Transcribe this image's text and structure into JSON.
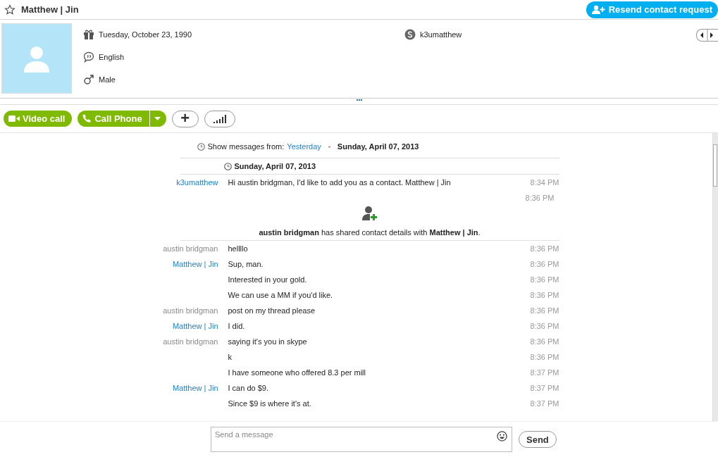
{
  "header": {
    "title": "Matthew | Jin",
    "favorite": false,
    "resend_button": "Resend contact request"
  },
  "profile": {
    "fields": [
      {
        "kind": "birthday",
        "text": "Tuesday, October 23, 1990"
      },
      {
        "kind": "language",
        "text": "English"
      },
      {
        "kind": "gender",
        "text": "Male"
      }
    ],
    "skype_name": "k3umatthew"
  },
  "toolbar": {
    "video_call": "Video call",
    "call_phone": "Call Phone",
    "add_symbol": "+"
  },
  "history": {
    "show_from_label": "Show messages from:",
    "show_from_link": "Yesterday",
    "current_date": "Sunday, April 07, 2013"
  },
  "date_header": "Sunday, April 07, 2013",
  "messages": [
    {
      "kind": "message",
      "sender": "k3umatthew",
      "color": "#1e82d2",
      "text": "Hi austin bridgman, I'd like to add you as a contact. Matthew | Jin",
      "time": "8:34 PM"
    },
    {
      "kind": "share",
      "text": "**austin bridgman** has shared contact details with **Matthew | Jin**.",
      "time": "8:36 PM"
    },
    {
      "kind": "message",
      "sender": "austin bridgman",
      "color": "#8a8a8a",
      "text": "hellllo",
      "time": "8:36 PM"
    },
    {
      "kind": "message",
      "sender": "Matthew | Jin",
      "color": "#1e82d2",
      "text": "Sup, man.",
      "time": "8:36 PM"
    },
    {
      "kind": "message",
      "text": "Interested in your gold.",
      "time": "8:36 PM"
    },
    {
      "kind": "message",
      "text": "We can use a MM if you'd like.",
      "time": "8:36 PM"
    },
    {
      "kind": "message",
      "sender": "austin bridgman",
      "color": "#8a8a8a",
      "text": "post on my thread please",
      "time": "8:36 PM"
    },
    {
      "kind": "message",
      "sender": "Matthew | Jin",
      "color": "#1e82d2",
      "text": "I did.",
      "time": "8:36 PM"
    },
    {
      "kind": "message",
      "sender": "austin bridgman",
      "color": "#8a8a8a",
      "text": "saying it's you in skype",
      "time": "8:36 PM"
    },
    {
      "kind": "message",
      "text": "k",
      "time": "8:36 PM"
    },
    {
      "kind": "message",
      "text": "I have someone who offered 8.3 per mill",
      "time": "8:37 PM"
    },
    {
      "kind": "message",
      "sender": "Matthew | Jin",
      "color": "#1e82d2",
      "text": "I can do $9.",
      "time": "8:37 PM"
    },
    {
      "kind": "message",
      "text": "Since $9 is where it's at.",
      "time": "8:37 PM"
    }
  ],
  "compose": {
    "placeholder": "Send a message",
    "send_button": "Send"
  }
}
